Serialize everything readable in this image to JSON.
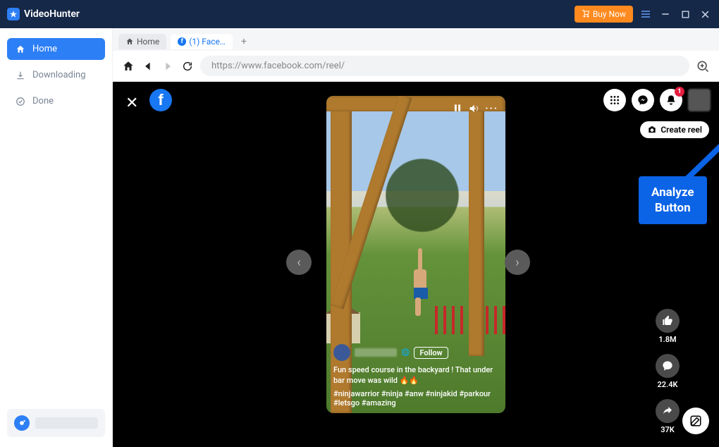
{
  "app": {
    "title": "VideoHunter",
    "buy_label": "Buy Now"
  },
  "sidebar": {
    "items": [
      {
        "label": "Home"
      },
      {
        "label": "Downloading"
      },
      {
        "label": "Done"
      }
    ]
  },
  "tabs": {
    "home": "Home",
    "fb": "(1) Face…"
  },
  "toolbar": {
    "url": "https://www.facebook.com/reel/"
  },
  "facebook": {
    "notify_badge": "1",
    "create_reel": "Create reel",
    "follow": "Follow",
    "caption": "Fun speed course in the backyard ! That under bar move was wild 🔥🔥",
    "hashtags": "#ninjawarrior #ninja #anw #ninjakid #parkour #letsgo #amazing",
    "actions": {
      "likes": "1.8M",
      "comments": "22.4K",
      "shares": "37K"
    }
  },
  "annotation": {
    "line1": "Analyze",
    "line2": "Button"
  }
}
